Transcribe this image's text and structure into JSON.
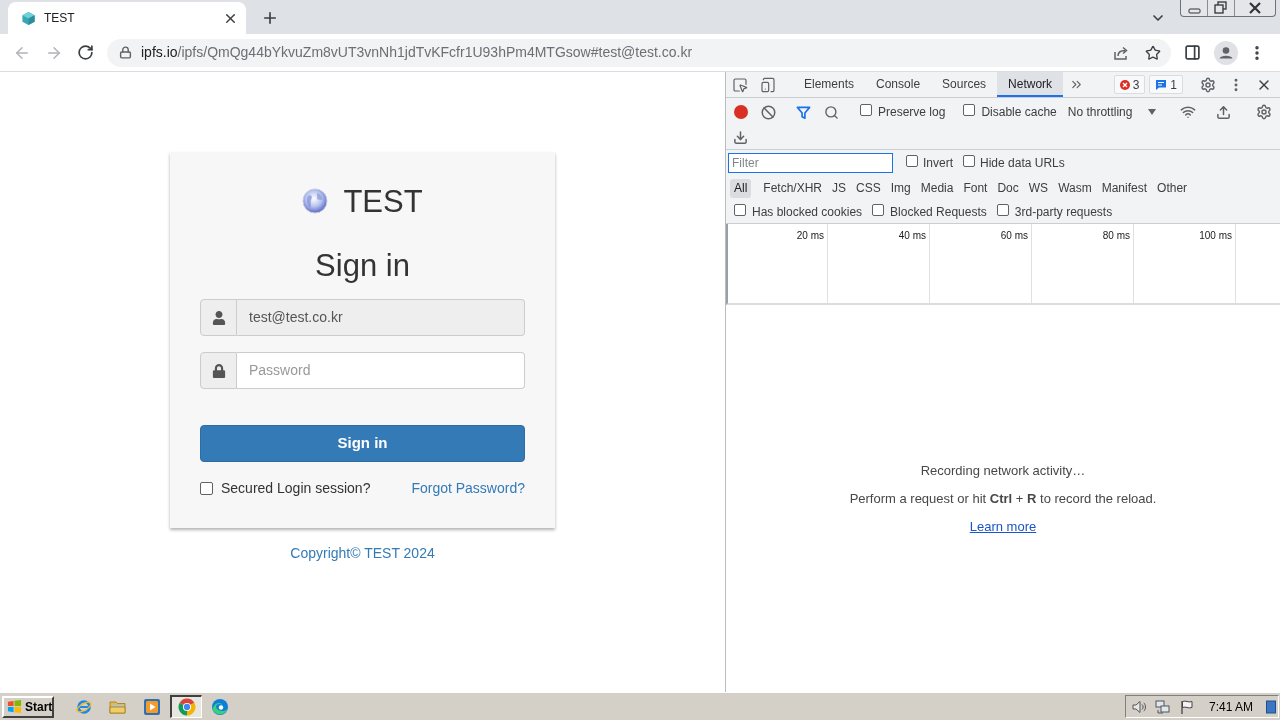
{
  "browser": {
    "tabs": [
      {
        "title": "TEST",
        "selected": true
      }
    ],
    "address_bar": {
      "domain": "ipfs.io",
      "path": "/ipfs/QmQg44bYkvuZm8vUT3vnNh1jdTvKFcfr1U93hPm4MTGsow#test@test.co.kr"
    }
  },
  "login": {
    "brand": "TEST",
    "heading": "Sign in",
    "email_field": {
      "value": "test@test.co.kr",
      "readonly": true
    },
    "password_field": {
      "placeholder": "Password"
    },
    "submit_button": "Sign in",
    "remember": {
      "label": "Secured Login session?",
      "checked": false
    },
    "forgot_link": "Forgot Password?",
    "footer": "Copyright© TEST 2024"
  },
  "devtools": {
    "tabs": [
      {
        "label": "Elements",
        "selected": false
      },
      {
        "label": "Console",
        "selected": false
      },
      {
        "label": "Sources",
        "selected": false
      },
      {
        "label": "Network",
        "selected": true
      }
    ],
    "error_count": "3",
    "message_count": "1",
    "recording": true,
    "toolbar_checkboxes": [
      {
        "label": "Preserve log",
        "checked": false
      },
      {
        "label": "Disable cache",
        "checked": false
      }
    ],
    "throttling": "No throttling",
    "filter": {
      "placeholder": "Filter"
    },
    "filter_checkboxes": [
      {
        "label": "Invert",
        "checked": false
      },
      {
        "label": "Hide data URLs",
        "checked": false
      }
    ],
    "resource_types": [
      {
        "label": "All",
        "selected": true
      },
      {
        "label": "Fetch/XHR",
        "selected": false
      },
      {
        "label": "JS",
        "selected": false
      },
      {
        "label": "CSS",
        "selected": false
      },
      {
        "label": "Img",
        "selected": false
      },
      {
        "label": "Media",
        "selected": false
      },
      {
        "label": "Font",
        "selected": false
      },
      {
        "label": "Doc",
        "selected": false
      },
      {
        "label": "WS",
        "selected": false
      },
      {
        "label": "Wasm",
        "selected": false
      },
      {
        "label": "Manifest",
        "selected": false
      },
      {
        "label": "Other",
        "selected": false
      }
    ],
    "request_checkboxes": [
      {
        "label": "Has blocked cookies",
        "checked": false
      },
      {
        "label": "Blocked Requests",
        "checked": false
      },
      {
        "label": "3rd-party requests",
        "checked": false
      }
    ],
    "timeline_ticks": [
      "20 ms",
      "40 ms",
      "60 ms",
      "80 ms",
      "100 ms"
    ],
    "empty_state": {
      "title": "Recording network activity…",
      "hint": "Perform a request or hit **Ctrl** + **R** to record the reload.",
      "link": "Learn more"
    }
  },
  "taskbar": {
    "start": "Start",
    "apps": [
      {
        "kind": "internet-explorer",
        "selected": false
      },
      {
        "kind": "file-explorer",
        "selected": false
      },
      {
        "kind": "media-player",
        "selected": false
      },
      {
        "kind": "chrome",
        "selected": true
      },
      {
        "kind": "edge",
        "selected": false
      }
    ],
    "clock": "7:41 AM"
  }
}
